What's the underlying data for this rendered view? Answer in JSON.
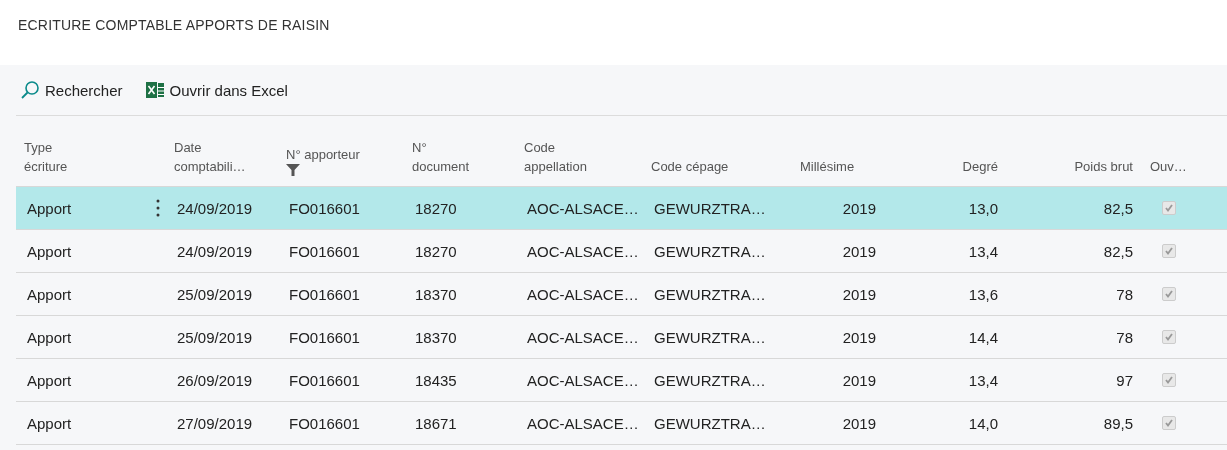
{
  "page_title": "ECRITURE COMPTABLE APPORTS DE RAISIN",
  "toolbar": [
    {
      "kind": "search",
      "label": "Rechercher"
    },
    {
      "kind": "excel",
      "label": "Ouvrir dans Excel"
    }
  ],
  "table": {
    "columns": [
      {
        "label": "Type\nécriture",
        "kind": "text",
        "filter": false
      },
      {
        "label": "Date\ncomptabili…",
        "kind": "text",
        "filter": false
      },
      {
        "label": "N° apporteur",
        "kind": "text",
        "filter": true
      },
      {
        "label": "N°\ndocument",
        "kind": "text",
        "filter": false
      },
      {
        "label": "Code\nappellation",
        "kind": "text",
        "filter": false
      },
      {
        "label": "Code cépage",
        "kind": "text",
        "filter": false
      },
      {
        "label": "Millésime",
        "kind": "year",
        "filter": false
      },
      {
        "label": "Degré",
        "kind": "number",
        "filter": false
      },
      {
        "label": "Poids brut",
        "kind": "number",
        "filter": false
      },
      {
        "label": "Ouv…",
        "kind": "check",
        "filter": false
      }
    ],
    "rows": [
      {
        "selected": true,
        "cells": [
          "Apport",
          "24/09/2019",
          "FO016601",
          "18270",
          "AOC-ALSACE…",
          "GEWURZTRA…",
          "2019",
          "13,0",
          "82,5"
        ],
        "checked": true
      },
      {
        "selected": false,
        "cells": [
          "Apport",
          "24/09/2019",
          "FO016601",
          "18270",
          "AOC-ALSACE…",
          "GEWURZTRA…",
          "2019",
          "13,4",
          "82,5"
        ],
        "checked": true
      },
      {
        "selected": false,
        "cells": [
          "Apport",
          "25/09/2019",
          "FO016601",
          "18370",
          "AOC-ALSACE…",
          "GEWURZTRA…",
          "2019",
          "13,6",
          "78"
        ],
        "checked": true
      },
      {
        "selected": false,
        "cells": [
          "Apport",
          "25/09/2019",
          "FO016601",
          "18370",
          "AOC-ALSACE…",
          "GEWURZTRA…",
          "2019",
          "14,4",
          "78"
        ],
        "checked": true
      },
      {
        "selected": false,
        "cells": [
          "Apport",
          "26/09/2019",
          "FO016601",
          "18435",
          "AOC-ALSACE…",
          "GEWURZTRA…",
          "2019",
          "13,4",
          "97"
        ],
        "checked": true
      },
      {
        "selected": false,
        "cells": [
          "Apport",
          "27/09/2019",
          "FO016601",
          "18671",
          "AOC-ALSACE…",
          "GEWURZTRA…",
          "2019",
          "14,0",
          "89,5"
        ],
        "checked": true
      }
    ]
  }
}
